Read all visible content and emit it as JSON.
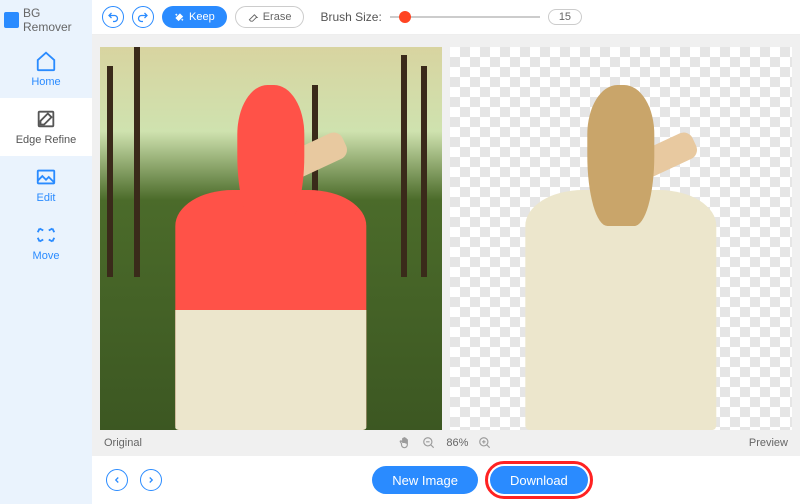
{
  "app": {
    "name": "BG Remover"
  },
  "sidebar": {
    "items": [
      {
        "label": "Home"
      },
      {
        "label": "Edge Refine"
      },
      {
        "label": "Edit"
      },
      {
        "label": "Move"
      }
    ]
  },
  "toolbar": {
    "keep_label": "Keep",
    "erase_label": "Erase",
    "brush_label": "Brush Size:",
    "brush_value": "15"
  },
  "status": {
    "original_label": "Original",
    "zoom_pct": "86%",
    "preview_label": "Preview"
  },
  "footer": {
    "new_image_label": "New Image",
    "download_label": "Download"
  }
}
